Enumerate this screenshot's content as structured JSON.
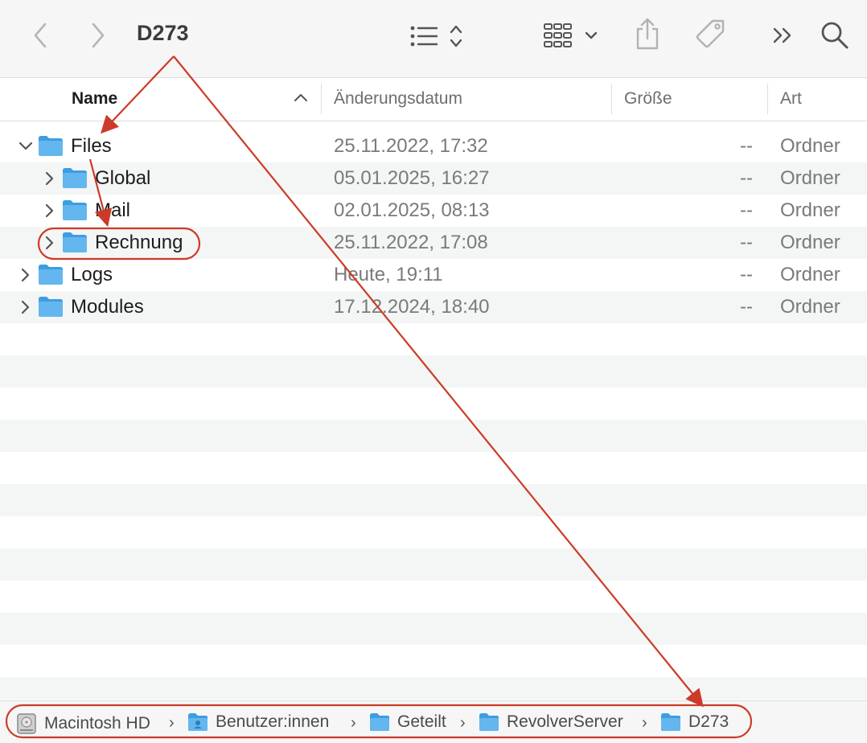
{
  "window": {
    "title": "D273"
  },
  "columns": {
    "name": "Name",
    "modified": "Änderungsdatum",
    "size": "Größe",
    "kind": "Art"
  },
  "rows": [
    {
      "name": "Files",
      "modified": "25.11.2022, 17:32",
      "size": "--",
      "kind": "Ordner",
      "expanded": true,
      "level": 0
    },
    {
      "name": "Global",
      "modified": "05.01.2025, 16:27",
      "size": "--",
      "kind": "Ordner",
      "expanded": false,
      "level": 1
    },
    {
      "name": "Mail",
      "modified": "02.01.2025, 08:13",
      "size": "--",
      "kind": "Ordner",
      "expanded": false,
      "level": 1
    },
    {
      "name": "Rechnung",
      "modified": "25.11.2022, 17:08",
      "size": "--",
      "kind": "Ordner",
      "expanded": false,
      "level": 1
    },
    {
      "name": "Logs",
      "modified": "Heute, 19:11",
      "size": "--",
      "kind": "Ordner",
      "expanded": false,
      "level": 0
    },
    {
      "name": "Modules",
      "modified": "17.12.2024, 18:40",
      "size": "--",
      "kind": "Ordner",
      "expanded": false,
      "level": 0
    }
  ],
  "pathbar": {
    "items": [
      "Macintosh HD",
      "Benutzer:innen",
      "Geteilt",
      "RevolverServer",
      "D273"
    ]
  },
  "icons": {
    "back": "chevron-left-icon",
    "forward": "chevron-right-icon",
    "list_view": "list-view-icon",
    "group": "grid-group-icon",
    "share": "share-icon",
    "tag": "tag-icon",
    "more": "more-icon",
    "search": "search-icon",
    "folder": "folder-icon",
    "disk": "hard-disk-icon"
  },
  "colors": {
    "annotation": "#cc3b27",
    "folder": "#5eb4ec",
    "stripe": "#f4f5f5"
  }
}
